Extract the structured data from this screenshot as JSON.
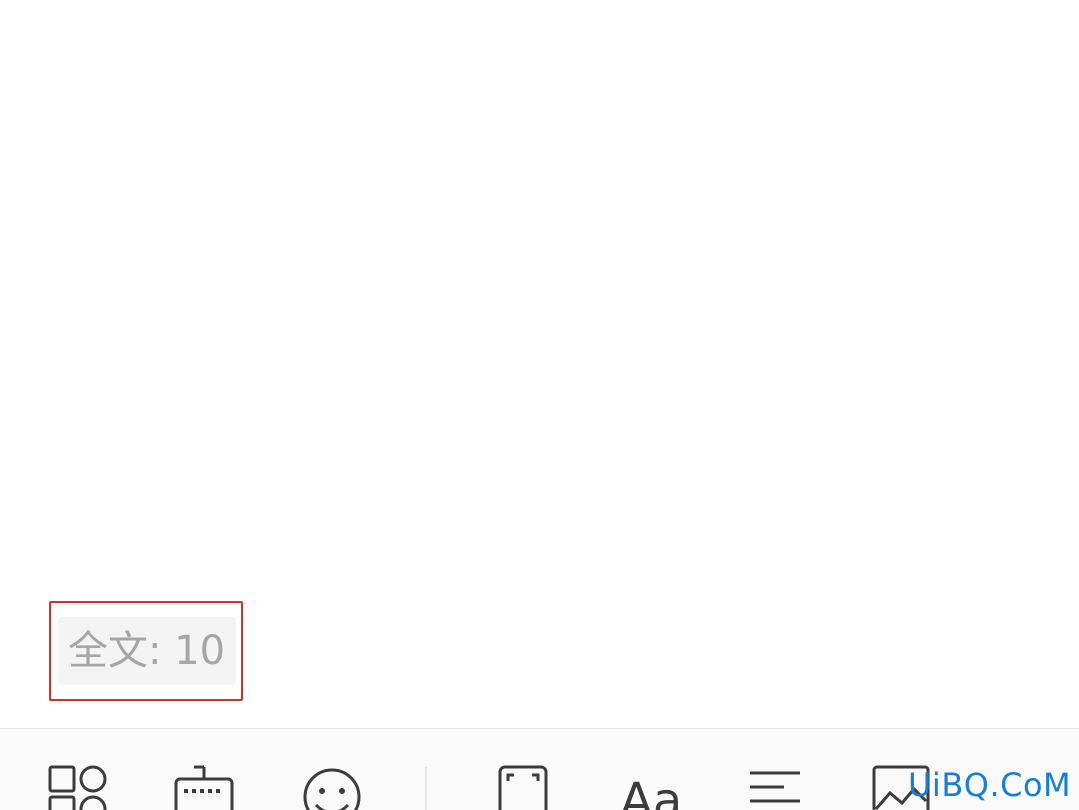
{
  "word_count": {
    "label": "全文: 10"
  },
  "toolbar": {
    "items": [
      {
        "icon": "apps-grid-icon"
      },
      {
        "icon": "keyboard-icon"
      },
      {
        "icon": "emoji-icon"
      },
      {
        "icon": "fullscreen-icon"
      },
      {
        "icon": "font-style-icon",
        "glyph": "Aa"
      },
      {
        "icon": "align-left-icon"
      },
      {
        "icon": "image-icon"
      }
    ]
  },
  "watermark": {
    "text": "UiBQ.CoM"
  },
  "colors": {
    "highlight_border": "#d0312d",
    "icon_stroke": "#3c3c3c",
    "label_gray": "#a6a6a6",
    "watermark_blue": "#1a7fd0"
  }
}
